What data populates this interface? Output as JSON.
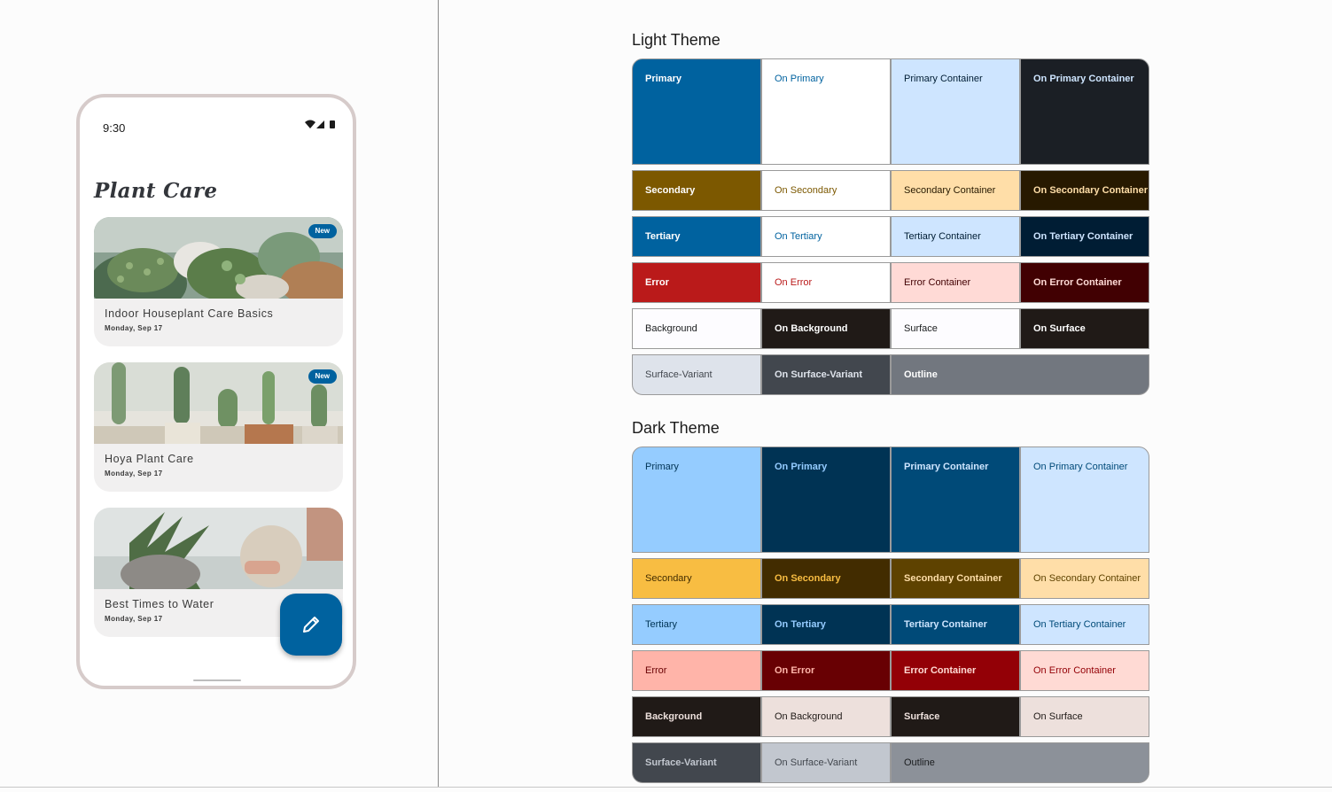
{
  "phone": {
    "status": {
      "time": "9:30",
      "icons": [
        "wifi-icon",
        "signal-icon",
        "battery-icon"
      ]
    },
    "app_title": "Plant Care",
    "cards": [
      {
        "title": "Indoor Houseplant Care Basics",
        "date": "Monday, Sep 17",
        "badge": "New",
        "image": "succulent-plants-photo"
      },
      {
        "title": "Hoya Plant Care",
        "date": "Monday, Sep 17",
        "badge": "New",
        "image": "cactus-pots-photo"
      },
      {
        "title": "Best Times to Water",
        "date": "Monday, Sep 17",
        "badge": "",
        "image": "watering-plant-photo"
      }
    ],
    "fab_icon": "pencil-icon",
    "accent": "#00629f"
  },
  "themes": [
    {
      "title": "Light Theme",
      "rows": [
        [
          {
            "label": "Primary",
            "bg": "#00629f",
            "fg": "#ffffff"
          },
          {
            "label": "On Primary",
            "bg": "#ffffff",
            "fg": "#00629f"
          },
          {
            "label": "Primary Container",
            "bg": "#cee5ff",
            "fg": "#001d34"
          },
          {
            "label": "On Primary Container",
            "bg": "#1b1f25",
            "fg": "#cee5ff"
          }
        ],
        [
          {
            "label": "Secondary",
            "bg": "#7c5800",
            "fg": "#ffffff"
          },
          {
            "label": "On Secondary",
            "bg": "#ffffff",
            "fg": "#7c5800"
          },
          {
            "label": "Secondary Container",
            "bg": "#ffdea8",
            "fg": "#271900"
          },
          {
            "label": "On Secondary Container",
            "bg": "#271900",
            "fg": "#ffdea8"
          }
        ],
        [
          {
            "label": "Tertiary",
            "bg": "#00629f",
            "fg": "#ffffff"
          },
          {
            "label": "On Tertiary",
            "bg": "#ffffff",
            "fg": "#00629f"
          },
          {
            "label": "Tertiary Container",
            "bg": "#cee5ff",
            "fg": "#001d34"
          },
          {
            "label": "On Tertiary Container",
            "bg": "#001d34",
            "fg": "#cee5ff"
          }
        ],
        [
          {
            "label": "Error",
            "bg": "#ba1a1a",
            "fg": "#ffffff"
          },
          {
            "label": "On Error",
            "bg": "#ffffff",
            "fg": "#ba1a1a"
          },
          {
            "label": "Error Container",
            "bg": "#ffdad6",
            "fg": "#410002"
          },
          {
            "label": "On Error Container",
            "bg": "#410002",
            "fg": "#ffdad6"
          }
        ],
        [
          {
            "label": "Background",
            "bg": "#fdfcff",
            "fg": "#1a1c1e"
          },
          {
            "label": "On Background",
            "bg": "#201a17",
            "fg": "#ffffff"
          },
          {
            "label": "Surface",
            "bg": "#fdfcff",
            "fg": "#1a1c1e"
          },
          {
            "label": "On Surface",
            "bg": "#201a17",
            "fg": "#ffffff"
          }
        ],
        [
          {
            "label": "Surface-Variant",
            "bg": "#dee3eb",
            "fg": "#42474e"
          },
          {
            "label": "On Surface-Variant",
            "bg": "#42474e",
            "fg": "#dee3eb"
          },
          {
            "label": "Outline",
            "bg": "#72777f",
            "fg": "#ffffff"
          }
        ]
      ]
    },
    {
      "title": "Dark Theme",
      "rows": [
        [
          {
            "label": "Primary",
            "bg": "#95ccff",
            "fg": "#003354"
          },
          {
            "label": "On Primary",
            "bg": "#003354",
            "fg": "#95ccff"
          },
          {
            "label": "Primary Container",
            "bg": "#004a78",
            "fg": "#cee5ff"
          },
          {
            "label": "On Primary Container",
            "bg": "#cee5ff",
            "fg": "#004a78"
          }
        ],
        [
          {
            "label": "Secondary",
            "bg": "#f8bd42",
            "fg": "#422c00"
          },
          {
            "label": "On Secondary",
            "bg": "#422c00",
            "fg": "#f8bd42"
          },
          {
            "label": "Secondary Container",
            "bg": "#5e4200",
            "fg": "#ffdea8"
          },
          {
            "label": "On Secondary Container",
            "bg": "#ffdea8",
            "fg": "#5e4200"
          }
        ],
        [
          {
            "label": "Tertiary",
            "bg": "#95ccff",
            "fg": "#003354"
          },
          {
            "label": "On Tertiary",
            "bg": "#003354",
            "fg": "#95ccff"
          },
          {
            "label": "Tertiary Container",
            "bg": "#004a78",
            "fg": "#cee5ff"
          },
          {
            "label": "On Tertiary Container",
            "bg": "#cee5ff",
            "fg": "#004a78"
          }
        ],
        [
          {
            "label": "Error",
            "bg": "#ffb4a9",
            "fg": "#680003"
          },
          {
            "label": "On Error",
            "bg": "#680003",
            "fg": "#ffb4a9"
          },
          {
            "label": "Error Container",
            "bg": "#930006",
            "fg": "#ffdad4"
          },
          {
            "label": "On Error Container",
            "bg": "#ffdad4",
            "fg": "#930006"
          }
        ],
        [
          {
            "label": "Background",
            "bg": "#201a17",
            "fg": "#ede0dc"
          },
          {
            "label": "On Background",
            "bg": "#ede0dc",
            "fg": "#201a17"
          },
          {
            "label": "Surface",
            "bg": "#201a17",
            "fg": "#ede0dc"
          },
          {
            "label": "On Surface",
            "bg": "#ede0dc",
            "fg": "#201a17"
          }
        ],
        [
          {
            "label": "Surface-Variant",
            "bg": "#42474e",
            "fg": "#c2c7cf"
          },
          {
            "label": "On Surface-Variant",
            "bg": "#c2c7cf",
            "fg": "#42474e"
          },
          {
            "label": "Outline",
            "bg": "#8c9199",
            "fg": "#1a1c1e"
          }
        ]
      ]
    }
  ]
}
